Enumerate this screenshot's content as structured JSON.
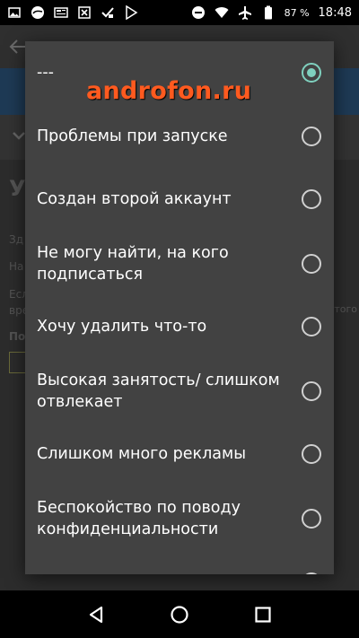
{
  "status_bar": {
    "battery_percent": "87 %",
    "time": "18:48",
    "left_icons": [
      "image-icon",
      "globe-icon",
      "news-icon",
      "excel-icon",
      "tasks-icon",
      "play-store-icon"
    ],
    "right_icons": [
      "dnd-icon",
      "wifi-icon",
      "airplane-icon",
      "battery-icon"
    ]
  },
  "background_page": {
    "title_fragment": "Уд",
    "line1": "Зд",
    "line2": "На",
    "line3": "Есл",
    "line4": "вре",
    "line5": "По",
    "right_fragment": "этого"
  },
  "dialog": {
    "options": [
      {
        "label": "---",
        "selected": true
      },
      {
        "label": "Проблемы при запуске",
        "selected": false
      },
      {
        "label": "Создан второй аккаунт",
        "selected": false
      },
      {
        "label": "Не могу найти, на кого подписаться",
        "selected": false
      },
      {
        "label": "Хочу удалить что-то",
        "selected": false
      },
      {
        "label": "Высокая занятость/ слишком отвлекает",
        "selected": false
      },
      {
        "label": "Слишком много рекламы",
        "selected": false
      },
      {
        "label": "Беспокойство по поводу конфиденциальности",
        "selected": false
      }
    ]
  },
  "watermark": "androfon.ru",
  "colors": {
    "accent": "#7fd0be",
    "dialog_bg": "#424242",
    "watermark": "#ff5a1f"
  }
}
